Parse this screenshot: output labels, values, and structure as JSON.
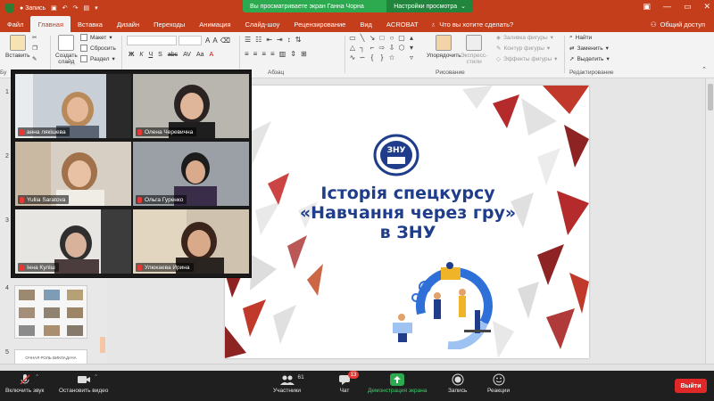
{
  "titlebar": {
    "record_label": "Запись",
    "share_banner": "Вы просматриваете экран Ганна Чорна",
    "view_options": "Настройки просмотра",
    "window_controls": [
      "—",
      "▭",
      "✕"
    ]
  },
  "ribbon_tabs": [
    {
      "label": "Файл",
      "active": false
    },
    {
      "label": "Главная",
      "active": true
    },
    {
      "label": "Вставка",
      "active": false
    },
    {
      "label": "Дизайн",
      "active": false
    },
    {
      "label": "Переходы",
      "active": false
    },
    {
      "label": "Анимация",
      "active": false
    },
    {
      "label": "Слайд-шоу",
      "active": false
    },
    {
      "label": "Рецензирование",
      "active": false
    },
    {
      "label": "Вид",
      "active": false
    },
    {
      "label": "ACROBAT",
      "active": false
    }
  ],
  "tell_me": "Что вы хотите сделать?",
  "share_access": "Общий доступ",
  "ribbon": {
    "paste": "Вставить",
    "new_slide_1": "Создать",
    "new_slide_2": "слайд",
    "layout": "Макет",
    "reset": "Сбросить",
    "section": "Раздел",
    "clipboard_label": "Бу",
    "paragraph_label": "Абзац",
    "arrange": "Упорядочить",
    "quick_styles_1": "Экспресс-",
    "quick_styles_2": "стили",
    "shape_fill": "Заливка фигуры",
    "shape_outline": "Контур фигуры",
    "shape_effects": "Эффекты фигуры",
    "drawing_label": "Рисование",
    "find": "Найти",
    "replace": "Заменить",
    "select": "Выделить",
    "editing_label": "Редактирование",
    "format_buttons": [
      "Ж",
      "К",
      "Ч",
      "S",
      "abc",
      "AV",
      "Aa",
      "A"
    ]
  },
  "slide_numbers": [
    "1",
    "2",
    "3",
    "4",
    "5"
  ],
  "thumb5_text": "ОЧНАЯ РОЛЬ ВИКЛАДАЧА",
  "slide": {
    "logo_text": "ЗНУ",
    "title_line1": "Історія спецкурсу",
    "title_line2": "«Навчання через гру»",
    "title_line3": "в ЗНУ"
  },
  "participants": [
    {
      "name": "анна лякішева"
    },
    {
      "name": "Олена Черевична"
    },
    {
      "name": "Yuliia Saratova"
    },
    {
      "name": "Ольга Гуренко"
    },
    {
      "name": "Інна Куліш"
    },
    {
      "name": "Улюкаева Ирина"
    }
  ],
  "zoom_toolbar": {
    "unmute": "Включить звук",
    "start_video": "Остановить видео",
    "participants": "Участники",
    "participants_count": "61",
    "chat": "Чат",
    "chat_badge": "13",
    "share_screen": "Демонстрация экрана",
    "record": "Запись",
    "reactions": "Реакции",
    "leave": "Выйти"
  },
  "colors": {
    "powerpoint_accent": "#c43e1c",
    "zoom_green": "#2da94f",
    "leave_red": "#e02828",
    "slide_title_blue": "#1f3d8a"
  }
}
